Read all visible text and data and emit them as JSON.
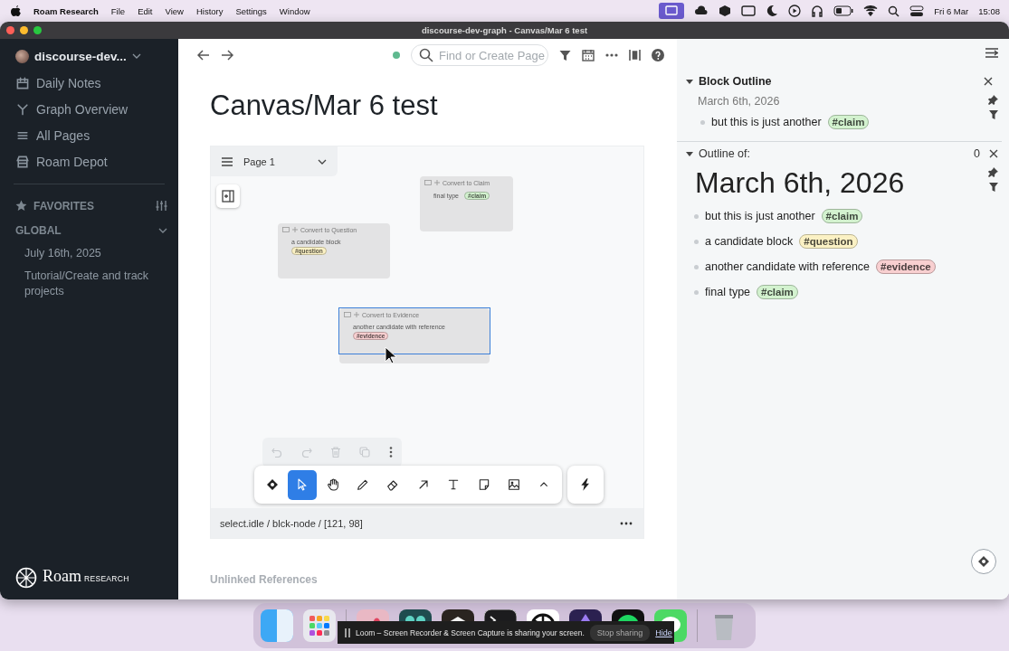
{
  "menubar": {
    "app": "Roam Research",
    "menus": [
      "File",
      "Edit",
      "View",
      "History",
      "Settings",
      "Window"
    ],
    "date": "Fri 6 Mar",
    "time": "15:08"
  },
  "window": {
    "title": "discourse-dev-graph - Canvas/Mar 6 test"
  },
  "sidebar": {
    "graph": "discourse-dev...",
    "nav": [
      "Daily Notes",
      "Graph Overview",
      "All Pages",
      "Roam Depot"
    ],
    "favorites": "FAVORITES",
    "global": {
      "label": "GLOBAL",
      "expanded": true,
      "items": [
        "July 16th, 2025",
        "Tutorial/Create and track projects"
      ]
    },
    "logo": "Roam",
    "logo_sub": "RESEARCH"
  },
  "main": {
    "search": {
      "placeholder": "Find or Create Page"
    },
    "title": "Canvas/Mar 6 test",
    "canvas": {
      "page": "Page 1",
      "nodes": [
        {
          "action": "Convert to Claim",
          "text": "final type",
          "tag": "#claim",
          "color": "#d3f2cf",
          "selected": false
        },
        {
          "action": "Convert to Question",
          "text": "a candidate block",
          "tag": "#question",
          "color": "#fbf1c4",
          "selected": false
        },
        {
          "action": "Convert to Evidence",
          "text": "another candidate with reference",
          "tag": "#evidence",
          "color": "#f8cfd0",
          "selected": true
        }
      ],
      "tools": [
        {
          "selected": false
        },
        {
          "selected": true
        },
        {
          "selected": false
        },
        {
          "selected": false
        },
        {
          "selected": false
        },
        {
          "selected": false
        },
        {
          "selected": false
        },
        {
          "selected": false
        },
        {
          "selected": false
        },
        {
          "selected": false
        }
      ],
      "status": "select.idle / blck-node / [121, 98]"
    },
    "unlinked": "Unlinked References"
  },
  "right_panel": {
    "block_outline": {
      "title": "Block Outline",
      "expanded": true,
      "date": "March 6th, 2026",
      "blocks": [
        {
          "text": "but this is just another",
          "tag": "#claim",
          "color": "#d3f2cf"
        }
      ]
    },
    "outline": {
      "label": "Outline of:",
      "expanded": true,
      "count": "0",
      "title": "March 6th, 2026",
      "blocks": [
        {
          "text": "but this is just another",
          "tag": "#claim",
          "color": "#d3f2cf"
        },
        {
          "text": "a candidate block",
          "tag": "#question",
          "color": "#fbf1c4"
        },
        {
          "text": "another candidate with reference",
          "tag": "#evidence",
          "color": "#f8cfd0"
        },
        {
          "text": "final type",
          "tag": "#claim",
          "color": "#d3f2cf"
        }
      ]
    }
  },
  "loom": {
    "message": "Loom – Screen Recorder & Screen Capture is sharing your screen.",
    "stop": "Stop sharing",
    "hide": "Hide"
  }
}
